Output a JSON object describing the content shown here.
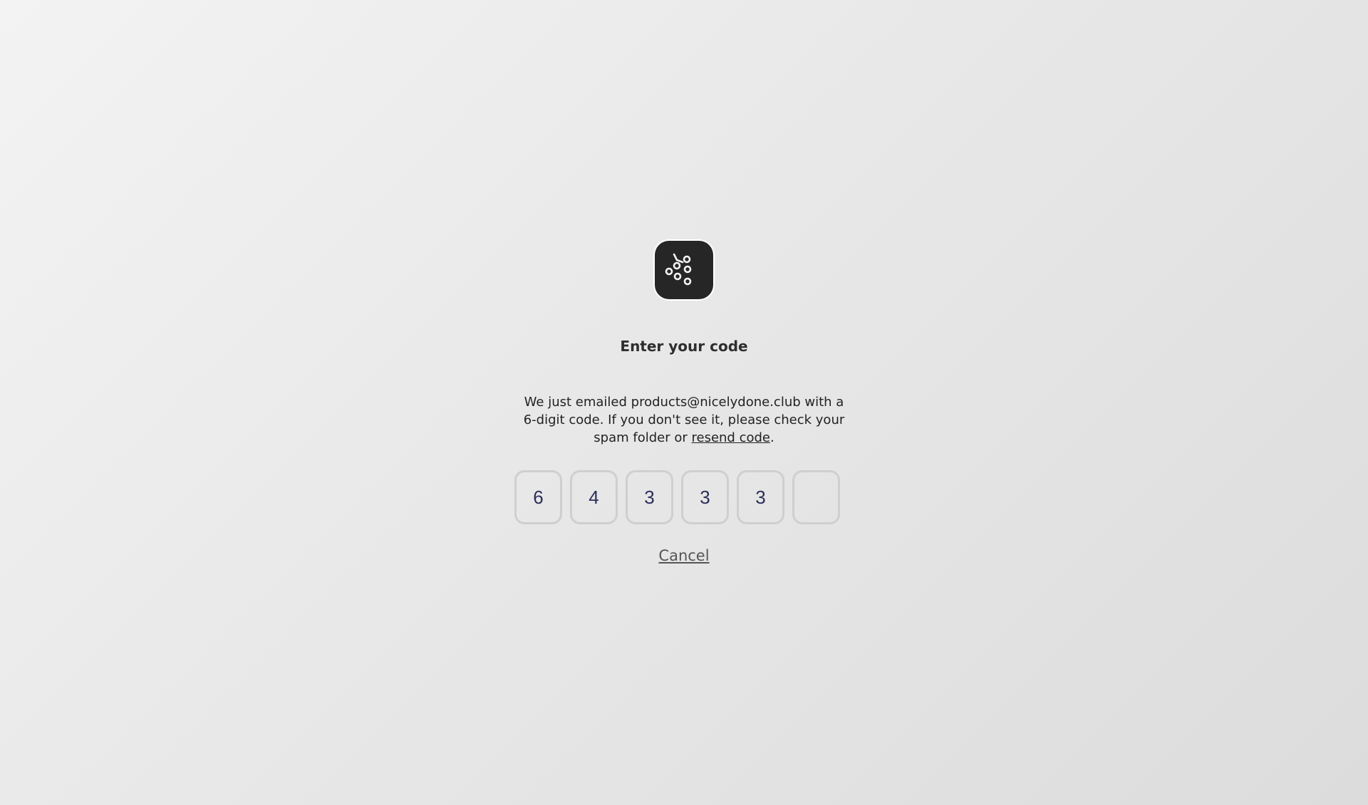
{
  "logo": {
    "icon": "grape-cluster-icon",
    "background": "#262626"
  },
  "heading": "Enter your code",
  "message": {
    "before_link": "We just emailed products@nicelydone.club with a 6-digit code. If you don't see it, please check your spam folder or ",
    "link_label": "resend code",
    "after_link": "."
  },
  "code_digits": [
    "6",
    "4",
    "3",
    "3",
    "3",
    ""
  ],
  "cancel_label": "Cancel",
  "colors": {
    "digit_text": "#2c2f5a",
    "box_border": "#cfcfcf"
  }
}
